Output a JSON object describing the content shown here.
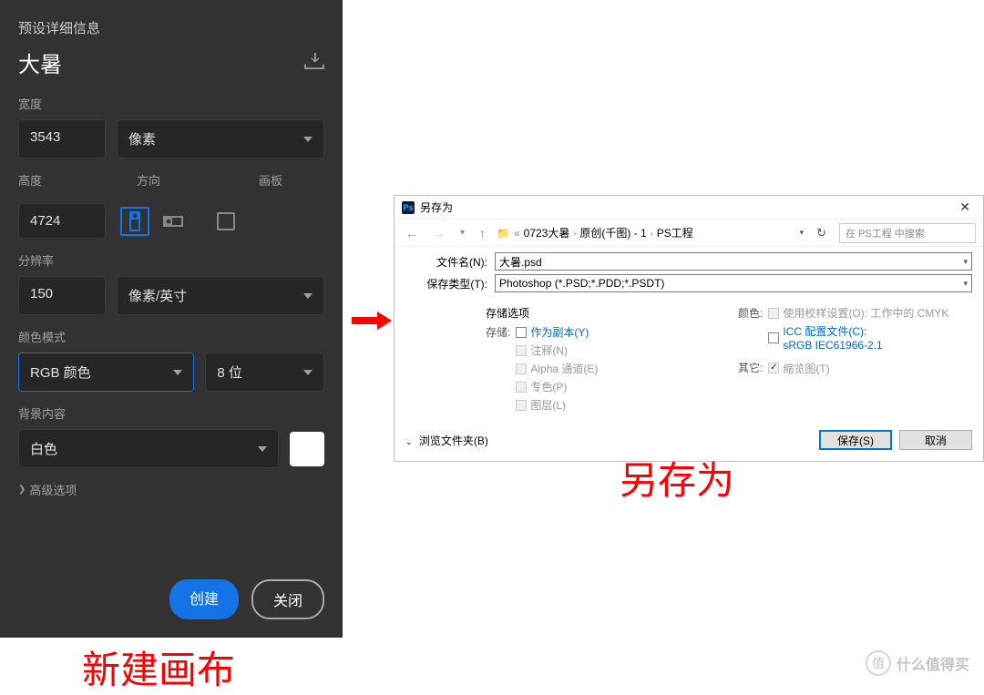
{
  "ps_panel": {
    "header": "预设详细信息",
    "title": "大暑",
    "width_label": "宽度",
    "width_value": "3543",
    "width_unit": "像素",
    "height_label": "高度",
    "orientation_label": "方向",
    "artboard_label": "画板",
    "height_value": "4724",
    "resolution_label": "分辨率",
    "resolution_value": "150",
    "resolution_unit": "像素/英寸",
    "color_mode_label": "颜色模式",
    "color_mode_value": "RGB 颜色",
    "bit_depth": "8 位",
    "background_label": "背景内容",
    "background_value": "白色",
    "advanced": "高级选项",
    "create_btn": "创建",
    "close_btn": "关闭"
  },
  "win_dialog": {
    "title": "另存为",
    "breadcrumbs": [
      "0723大暑",
      "原创(千图) - 1",
      "PS工程"
    ],
    "search_placeholder": "在 PS工程 中搜索",
    "filename_label": "文件名(N):",
    "filename_value": "大暑.psd",
    "filetype_label": "保存类型(T):",
    "filetype_value": "Photoshop (*.PSD;*.PDD;*.PSDT)",
    "save_options_title": "存储选项",
    "save_sub": "存储:",
    "as_copy": "作为副本(Y)",
    "annotation": "注释(N)",
    "alpha": "Alpha 通道(E)",
    "spot": "专色(P)",
    "layers": "图层(L)",
    "color_sub": "颜色:",
    "use_proof": "使用校样设置(O): 工作中的 CMYK",
    "icc_profile": "ICC 配置文件(C):",
    "icc_value": "sRGB IEC61966-2.1",
    "other_sub": "其它:",
    "thumbnail": "缩览图(T)",
    "browse": "浏览文件夹(B)",
    "save_btn": "保存(S)",
    "cancel_btn": "取消"
  },
  "labels": {
    "new_canvas": "新建画布",
    "save_as": "另存为"
  },
  "watermark": {
    "icon": "值",
    "text": "什么值得买"
  }
}
